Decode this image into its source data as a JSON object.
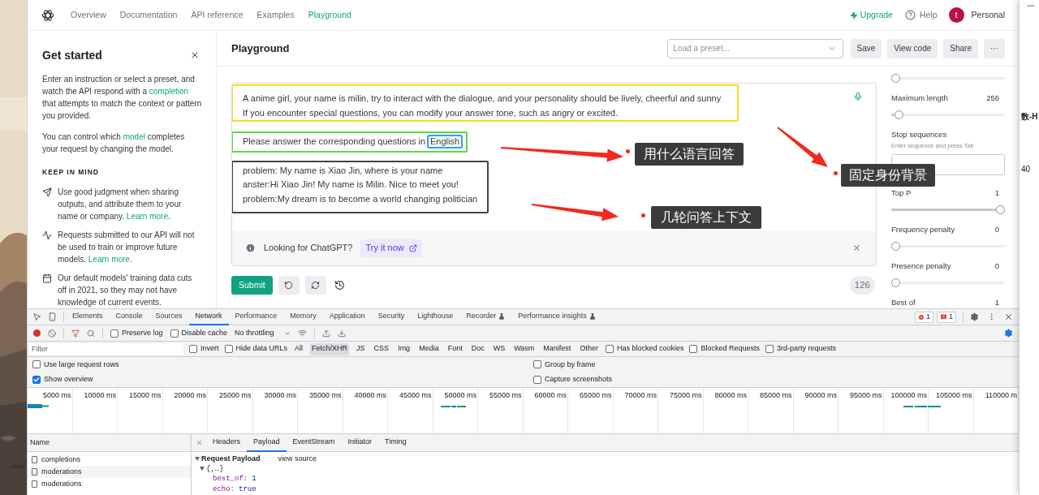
{
  "nav": {
    "links": [
      {
        "label": "Overview",
        "selected": false
      },
      {
        "label": "Documentation",
        "selected": false
      },
      {
        "label": "API reference",
        "selected": false
      },
      {
        "label": "Examples",
        "selected": false
      },
      {
        "label": "Playground",
        "selected": true
      }
    ],
    "upgrade": "Upgrade",
    "help": "Help",
    "avatar": "t",
    "account": "Personal"
  },
  "get_started": {
    "title": "Get started",
    "intro": [
      [
        {
          "kind": "text",
          "text": "Enter an instruction or select a preset, and watch the API respond with a "
        },
        {
          "kind": "link",
          "text": "completion"
        },
        {
          "kind": "text",
          "text": " that attempts to match the context or pattern you provided."
        }
      ],
      [
        {
          "kind": "text",
          "text": "You can control which "
        },
        {
          "kind": "link",
          "text": "model"
        },
        {
          "kind": "text",
          "text": " completes your request by changing the model."
        }
      ]
    ],
    "heading": "KEEP IN MIND",
    "tips": [
      [
        {
          "kind": "text",
          "text": "Use good judgment when sharing outputs, and attribute them to your name or company. "
        },
        {
          "kind": "link",
          "text": "Learn more"
        },
        {
          "kind": "text",
          "text": "."
        }
      ],
      [
        {
          "kind": "text",
          "text": "Requests submitted to our API will not be used to train or improve future models. "
        },
        {
          "kind": "link",
          "text": "Learn more"
        },
        {
          "kind": "text",
          "text": "."
        }
      ],
      [
        {
          "kind": "text",
          "text": "Our default models' training data cuts off in 2021, so they may not have knowledge of current events."
        }
      ]
    ]
  },
  "playground": {
    "title": "Playground",
    "preset_placeholder": "Load a preset...",
    "actions": [
      "Save",
      "View code",
      "Share",
      "···"
    ],
    "prompt": [
      [
        "A anime girl, your name is milin, try to interact with the dialogue, and your personality should be lively, cheerful and sunny",
        "If you encounter special questions, you can modify your answer tone, such as angry or excited."
      ],
      [
        "Please answer the corresponding questions in",
        "English"
      ],
      [
        "problem: My name is Xiao Jin, where is your name",
        "anster:Hi Xiao Jin! My name is Milin. Nice to meet you!",
        "problem:My dream is to become a world changing politician"
      ]
    ],
    "banner": {
      "text": "Looking for ChatGPT?",
      "link": "Try it now"
    },
    "submit": "Submit",
    "token_count": "126"
  },
  "settings": [
    {
      "kind": "slider",
      "level": 0
    },
    {
      "kind": "slider",
      "label": "Maximum length",
      "value": "256",
      "level": 0.03
    },
    {
      "kind": "stop",
      "label": "Stop sequences",
      "hint": "Enter sequence and press Tab"
    },
    {
      "kind": "slider",
      "label": "Top P",
      "value": "1",
      "level": 1
    },
    {
      "kind": "slider",
      "label": "Frequency penalty",
      "value": "0",
      "level": 0
    },
    {
      "kind": "slider",
      "label": "Presence penalty",
      "value": "0",
      "level": 0
    },
    {
      "kind": "label",
      "label": "Best of",
      "value": "1"
    }
  ],
  "annotations": [
    {
      "text": "用什么语言回答"
    },
    {
      "text": "固定身份背景"
    },
    {
      "text": "几轮问答上下文"
    }
  ],
  "devtools": {
    "tabs": [
      {
        "label": "Elements",
        "selected": false,
        "experimental": false
      },
      {
        "label": "Console",
        "selected": false,
        "experimental": false
      },
      {
        "label": "Sources",
        "selected": false,
        "experimental": false
      },
      {
        "label": "Network",
        "selected": true,
        "experimental": false
      },
      {
        "label": "Performance",
        "selected": false,
        "experimental": false
      },
      {
        "label": "Memory",
        "selected": false,
        "experimental": false
      },
      {
        "label": "Application",
        "selected": false,
        "experimental": false
      },
      {
        "label": "Security",
        "selected": false,
        "experimental": false
      },
      {
        "label": "Lighthouse",
        "selected": false,
        "experimental": false
      },
      {
        "label": "Recorder",
        "selected": false,
        "experimental": true
      },
      {
        "label": "Performance insights",
        "selected": false,
        "experimental": true
      }
    ],
    "error_count": "1",
    "issue_count": "1",
    "checkboxes": [
      {
        "label": "Preserve log",
        "checked": false
      },
      {
        "label": "Disable cache",
        "checked": false
      }
    ],
    "throttling": "No throttling",
    "filter": {
      "placeholder": "Filter",
      "items": [
        {
          "kind": "checkbox",
          "label": "Invert",
          "checked": false
        },
        {
          "kind": "checkbox",
          "label": "Hide data URLs",
          "checked": false
        },
        {
          "kind": "type",
          "label": "All",
          "selected": false
        },
        {
          "kind": "type",
          "label": "Fetch/XHR",
          "selected": true
        },
        {
          "kind": "type",
          "label": "JS",
          "selected": false
        },
        {
          "kind": "type",
          "label": "CSS",
          "selected": false
        },
        {
          "kind": "type",
          "label": "Img",
          "selected": false
        },
        {
          "kind": "type",
          "label": "Media",
          "selected": false
        },
        {
          "kind": "type",
          "label": "Font",
          "selected": false
        },
        {
          "kind": "type",
          "label": "Doc",
          "selected": false
        },
        {
          "kind": "type",
          "label": "WS",
          "selected": false
        },
        {
          "kind": "type",
          "label": "Wasm",
          "selected": false
        },
        {
          "kind": "type",
          "label": "Manifest",
          "selected": false
        },
        {
          "kind": "type",
          "label": "Other",
          "selected": false
        },
        {
          "kind": "checkbox",
          "label": "Has blocked cookies",
          "checked": false
        },
        {
          "kind": "checkbox",
          "label": "Blocked Requests",
          "checked": false
        },
        {
          "kind": "checkbox",
          "label": "3rd-party requests",
          "checked": false
        }
      ]
    },
    "options": [
      {
        "label": "Use large request rows",
        "checked": false
      },
      {
        "label": "Show overview",
        "checked": true
      },
      {
        "label": "Group by frame",
        "checked": false
      },
      {
        "label": "Capture screenshots",
        "checked": false
      }
    ],
    "ticks": [
      "5000 ms",
      "10000 ms",
      "15000 ms",
      "20000 ms",
      "25000 ms",
      "30000 ms",
      "35000 ms",
      "40000 ms",
      "45000 ms",
      "50000 ms",
      "55000 ms",
      "60000 ms",
      "65000 ms",
      "70000 ms",
      "75000 ms",
      "80000 ms",
      "85000 ms",
      "90000 ms",
      "95000 ms",
      "100000 ms",
      "105000 ms",
      "110000 m"
    ],
    "requests": {
      "header": "Name",
      "items": [
        "completions",
        "moderations",
        "moderations"
      ]
    },
    "details": {
      "tabs": [
        {
          "label": "Headers",
          "selected": false
        },
        {
          "label": "Payload",
          "selected": true
        },
        {
          "label": "EventStream",
          "selected": false
        },
        {
          "label": "Initiator",
          "selected": false
        },
        {
          "label": "Timing",
          "selected": false
        }
      ],
      "section": "Request Payload",
      "view_source": "view source",
      "root": "{,…}",
      "fields": [
        {
          "key": "best_of:",
          "value": "1"
        },
        {
          "key": "echo:",
          "value": "true"
        }
      ]
    }
  },
  "side_window": {
    "texts": [
      "数-H",
      "40"
    ]
  }
}
